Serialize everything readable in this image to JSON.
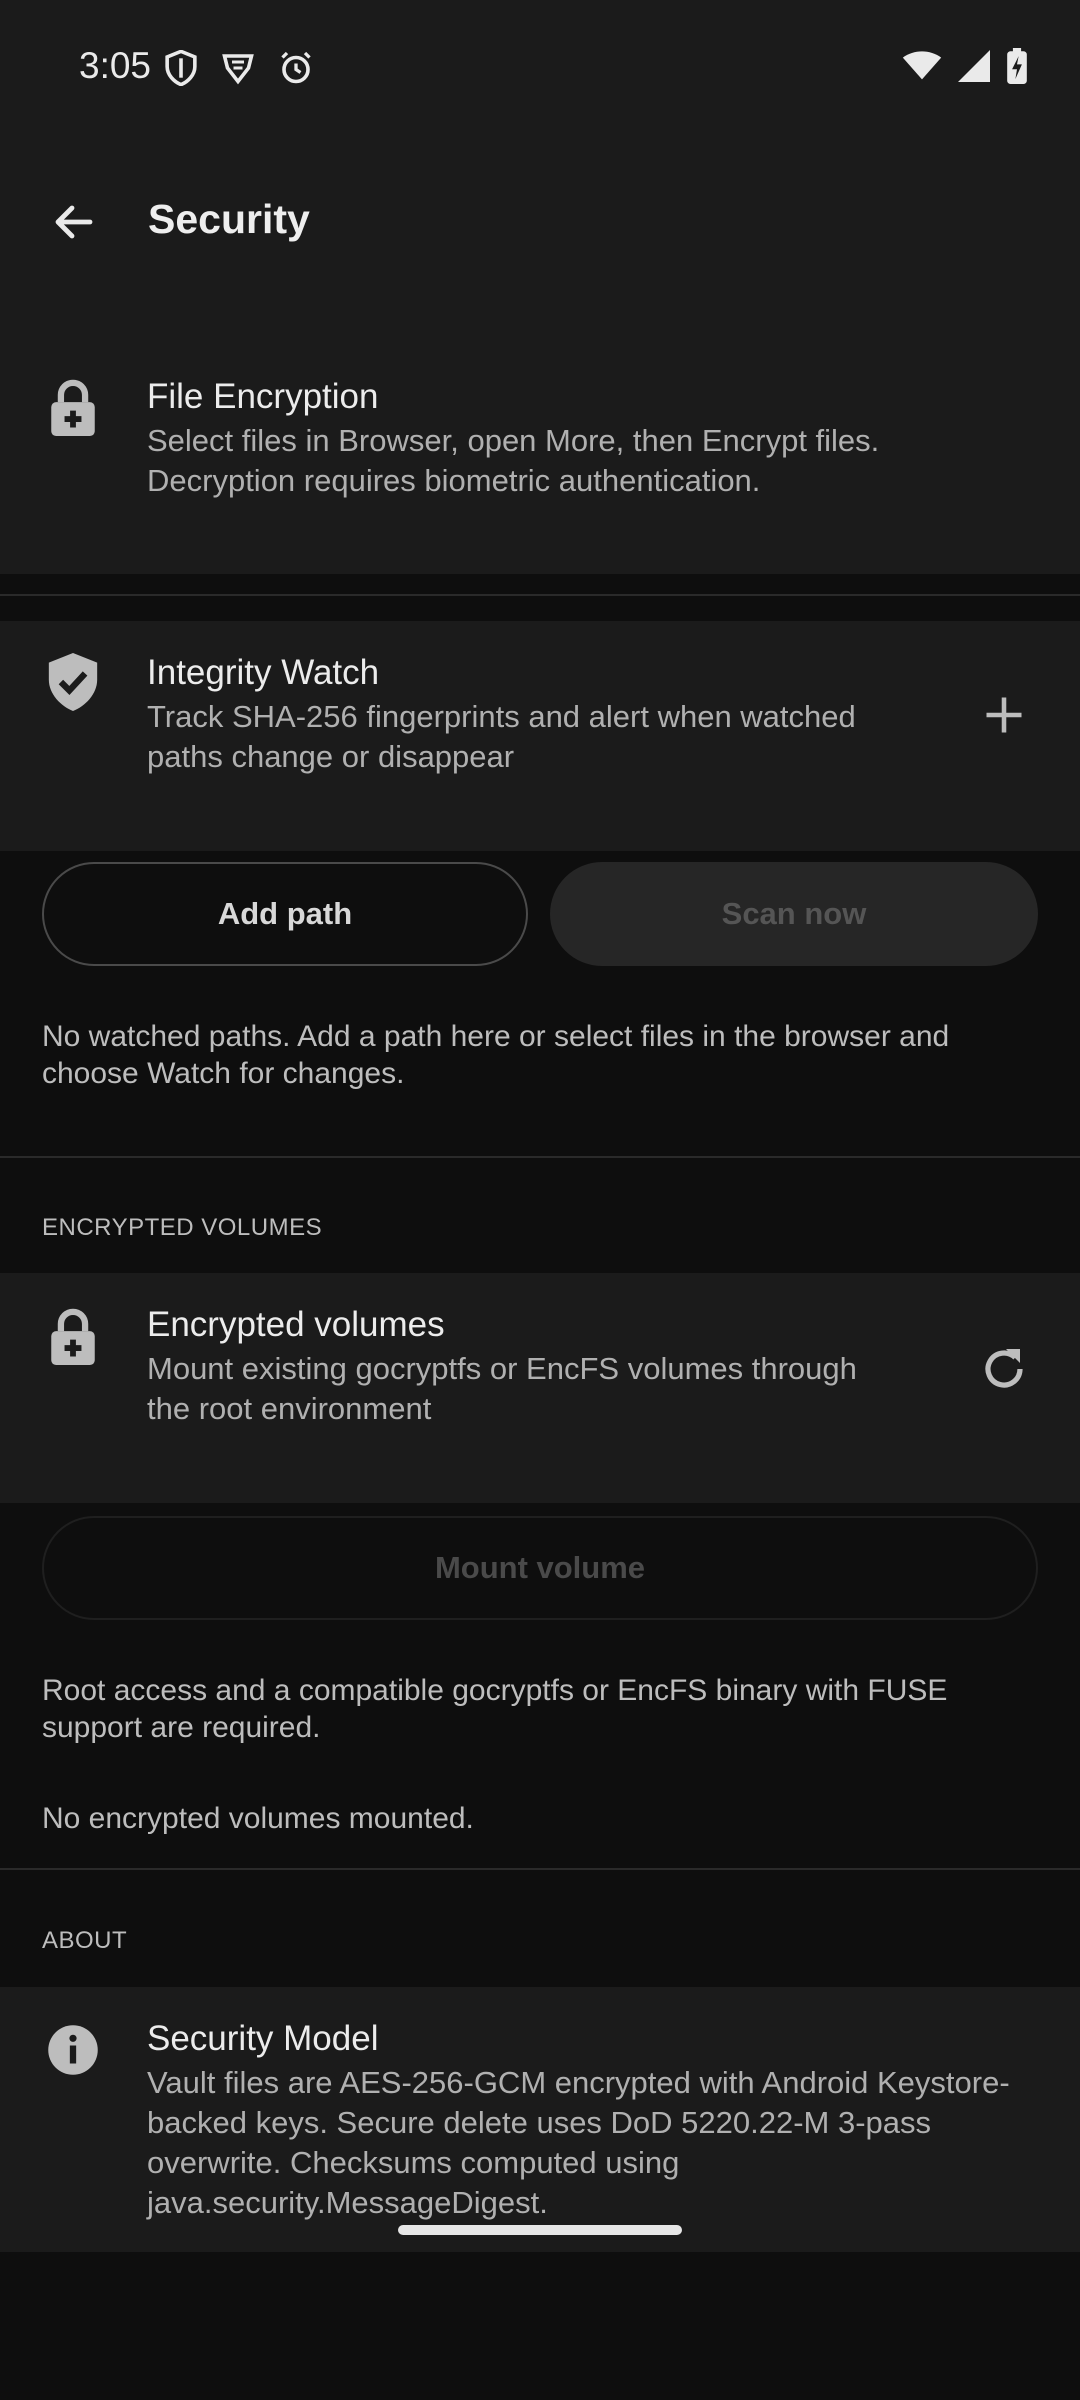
{
  "status_bar": {
    "time": "3:05",
    "left_icons": [
      "shield-icon",
      "brave-icon",
      "alarm-icon"
    ],
    "right_icons": [
      "wifi-icon",
      "signal-icon",
      "battery-charging-icon"
    ]
  },
  "app_bar": {
    "title": "Security",
    "back_icon": "arrow-back-icon"
  },
  "file_encryption": {
    "icon": "lock-icon",
    "title": "File Encryption",
    "description": "Select files in Browser, open More, then Encrypt files. Decryption requires biometric authentication."
  },
  "integrity_watch": {
    "icon": "shield-check-icon",
    "title": "Integrity Watch",
    "description": "Track SHA-256 fingerprints and alert when watched paths change or disappear",
    "action_icon": "plus-icon",
    "add_path_label": "Add path",
    "scan_now_label": "Scan now",
    "empty_note": "No watched paths. Add a path here or select files in the browser and choose Watch for changes."
  },
  "encrypted_volumes_section": {
    "header": "ENCRYPTED VOLUMES",
    "icon": "lock-icon",
    "title": "Encrypted volumes",
    "description": "Mount existing gocryptfs or EncFS volumes through the root environment",
    "action_icon": "refresh-icon",
    "mount_label": "Mount volume",
    "requirements_note": "Root access and a compatible gocryptfs or EncFS binary with FUSE support are required.",
    "empty_note": "No encrypted volumes mounted."
  },
  "about_section": {
    "header": "ABOUT",
    "icon": "info-icon",
    "title": "Security Model",
    "description": "Vault files are AES-256-GCM encrypted with Android Keystore-backed keys. Secure delete uses DoD 5220.22-M 3-pass overwrite. Checksums computed using java.security.MessageDigest."
  },
  "colors": {
    "background": "#0e0e0e",
    "surface": "#1b1b1b",
    "text_primary": "#ececec",
    "text_secondary": "#b0b0b0"
  }
}
